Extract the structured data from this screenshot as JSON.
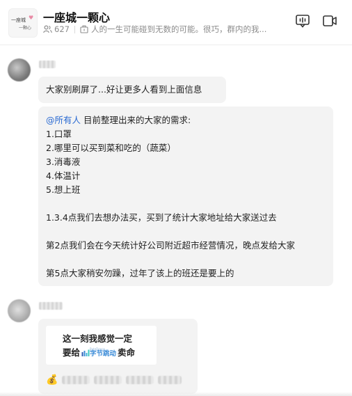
{
  "header": {
    "group_name": "一座城一颗心",
    "avatar_line1": "一座城",
    "avatar_line2": "一颗心",
    "member_count": "627",
    "announcement": "人的一生可能碰到无数的可能。很巧，群内的我...",
    "icons": [
      "members-icon",
      "announcement-icon",
      "voice-room-icon",
      "video-icon"
    ]
  },
  "messages": [
    {
      "text": "大家别刷屏了...好让更多人看到上面信息"
    },
    {
      "mention": "@所有人",
      "lines": [
        "目前整理出来的大家的需求:",
        "1.口罩",
        "2.哪里可以买到菜和吃的（蔬菜）",
        "3.消毒液",
        "4.体温计",
        "5.想上班",
        "",
        "1.3.4点我们去想办法买，买到了统计大家地址给大家送过去",
        "",
        "第2点我们会在今天统计好公司附近超市经营情况，晚点发给大家",
        "",
        "第5点大家稍安勿躁，过年了该上的班还是要上的"
      ]
    },
    {
      "card_line1": "这一刻我感觉一定",
      "card_line2_pre": "要给",
      "card_brand": "字节跳动",
      "card_brand_small": "ByteDance",
      "card_line2_post": "卖命",
      "reaction_icon": "money-bag-icon"
    }
  ],
  "colors": {
    "mention": "#2a6ad2",
    "bubble": "#f3f3f3",
    "brand": "#3c8cd8"
  }
}
